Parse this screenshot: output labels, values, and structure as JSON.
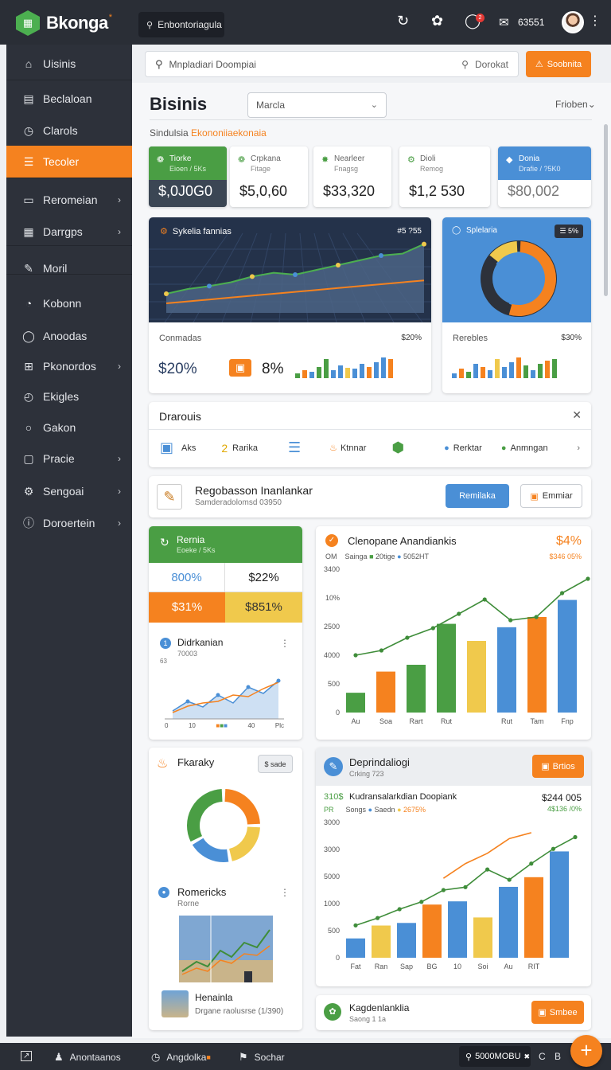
{
  "topbar": {
    "brand_name": "Bkonga",
    "brand_star": "*",
    "location": "Enbontoriagula",
    "mail_count": "63551",
    "notif_count": "2"
  },
  "sidebar": {
    "items": [
      {
        "label": "Uisinis",
        "icon": "home-icon",
        "arrow": false
      },
      {
        "label": "Beclaloan",
        "icon": "clipboard-icon",
        "arrow": false
      },
      {
        "label": "Clarols",
        "icon": "clock-icon",
        "arrow": false
      },
      {
        "label": "Tecoler",
        "icon": "list-icon",
        "arrow": false,
        "active": true
      },
      {
        "label": "Reromeian",
        "icon": "folder-icon",
        "arrow": true
      },
      {
        "label": "Darrgps",
        "icon": "calendar-icon",
        "arrow": true
      },
      {
        "label": "Moril",
        "icon": "pen-icon",
        "arrow": false
      },
      {
        "label": "Kobonn",
        "icon": "timer-icon",
        "arrow": false
      },
      {
        "label": "Anoodas",
        "icon": "bulb-icon",
        "arrow": false
      },
      {
        "label": "Pkonordos",
        "icon": "grid-icon",
        "arrow": true
      },
      {
        "label": "Ekigles",
        "icon": "alarm-icon",
        "arrow": false
      },
      {
        "label": "Gakon",
        "icon": "circle-icon",
        "arrow": false
      },
      {
        "label": "Pracie",
        "icon": "document-icon",
        "arrow": true
      },
      {
        "label": "Sengoai",
        "icon": "gear-icon",
        "arrow": true
      },
      {
        "label": "Doroertein",
        "icon": "info-icon",
        "arrow": true
      }
    ]
  },
  "search": {
    "placeholder": "Mnpladiari Doompiai",
    "right_label": "Dorokat",
    "button_label": "Soobnita"
  },
  "page": {
    "title": "Bisinis",
    "select_value": "Marcla",
    "filter_label": "Frioben",
    "subline_a": "Sindulsia",
    "subline_b": "Ekononiiaekonaia"
  },
  "kpis": [
    {
      "label": "Tiorke",
      "sub": "Eioen / 5Ks",
      "value": "$,0J0G0",
      "style": "green",
      "icon": "leaf-icon"
    },
    {
      "label": "Crpkana",
      "sub": "Fitage",
      "value": "$5,0,60",
      "style": "white",
      "icon": "leaf-icon"
    },
    {
      "label": "Nearleer",
      "sub": "Fnagsg",
      "value": "$33,320",
      "style": "white",
      "icon": "spark-icon"
    },
    {
      "label": "Dioli",
      "sub": "Remog",
      "value": "$1,2 530",
      "style": "white",
      "icon": "gear-icon"
    },
    {
      "label": "Donia",
      "sub": "Drafie / ?5K0",
      "value": "$80,002",
      "style": "blue",
      "icon": "shield-icon"
    }
  ],
  "overview": {
    "title": "Sykelia fannias",
    "corner": "#5 ?55",
    "foot_label": "Conmadas",
    "foot_pct": "$20%",
    "stat_a": "$20%",
    "stat_b": "8%"
  },
  "donut_card": {
    "title": "Splelaria",
    "badge": "☰ 5%",
    "foot_label": "Rerebles",
    "foot_pct": "$30%"
  },
  "drarouis": {
    "title": "Drarouis",
    "tabs": [
      "Aks",
      "Rarika",
      "",
      "Ktnnar",
      "",
      "Rerktar",
      "Anmngan"
    ],
    "tab_numeral": "2"
  },
  "regobasson": {
    "title": "Regobasson Inanlankar",
    "sub": "Samderadolomsd 03950",
    "btn_primary": "Remilaka",
    "btn_secondary": "Emmiar"
  },
  "mini_card": {
    "title": "Rernia",
    "sub": "Eoeke / 5Ks",
    "cells": [
      "800%",
      "$22%",
      "$31%",
      "$851%"
    ],
    "sub_title": "Didrkanian",
    "sub_sub": "70003",
    "y_top": "63",
    "x_labels": [
      "0",
      "10",
      "",
      "40",
      "Plc"
    ]
  },
  "main_chart": {
    "title": "Clenopane Anandiankis",
    "pct": "$4%",
    "sub_pct": "$346 05%",
    "legend_prefix": "OM",
    "legend_a": "Sainga",
    "legend_b": "20tige",
    "legend_c": "5052HT"
  },
  "fkaraky": {
    "title": "Fkaraky",
    "btn": "$ sade"
  },
  "romericks": {
    "title": "Romericks",
    "sub": "Rorne"
  },
  "henainla": {
    "title": "Henainla",
    "sub": "Drgane raolusrse (1/390)"
  },
  "dep_chart": {
    "title": "Deprindaliogi",
    "sub": "Crking 723",
    "btn": "Brtios",
    "head_left": "Kudransalarkdian Doopiank",
    "head_left_num": "310$",
    "head_right": "$244 005",
    "head_right_sub": "4$136 /0%",
    "legend_a": "Songs",
    "legend_b": "Saedn",
    "legend_c": "2675%",
    "legend_prefix": "PR"
  },
  "kagden": {
    "title": "Kagdenlanklia",
    "sub": "Saong 1 1a",
    "btn": "Smbee"
  },
  "bottombar": {
    "a": "Anontaanos",
    "b": "Angdolka",
    "c": "Sochar",
    "search": "5000MOBU",
    "d": "C",
    "e": "B"
  },
  "colors": {
    "orange": "#f5821f",
    "green": "#4a9e44",
    "blue": "#4a8fd6",
    "yellow": "#f0c94c",
    "dark": "#2d313a"
  },
  "chart_data": [
    {
      "type": "line",
      "title": "Sykelia fannias",
      "series": [
        {
          "values": [
            20,
            25,
            28,
            32,
            38,
            42,
            40,
            45,
            50,
            55,
            60,
            62,
            72
          ]
        },
        {
          "values": [
            10,
            12,
            14,
            16,
            18,
            20,
            22,
            24,
            26,
            28,
            30,
            32,
            34
          ]
        }
      ]
    },
    {
      "type": "pie",
      "title": "Splelaria",
      "values": [
        55,
        30,
        15
      ],
      "colors": [
        "#f5821f",
        "#2d313a",
        "#f0c94c"
      ]
    },
    {
      "type": "bar",
      "title": "Clenopane Anandiankis",
      "categories": [
        "Au",
        "Soa",
        "Rart",
        "Rut",
        "",
        "Rut",
        "Tam",
        "Fnp"
      ],
      "values": [
        580,
        1200,
        1400,
        2600,
        2100,
        2500,
        2800,
        3300
      ],
      "line": [
        1800,
        1950,
        2350,
        2650,
        3100,
        3550,
        2900,
        3000,
        3750,
        4200
      ],
      "y_ticks": [
        "3400",
        "10%",
        "2500",
        "4000",
        "500",
        "0"
      ]
    },
    {
      "type": "bar",
      "title": "Deprindaliogi",
      "categories": [
        "Fat",
        "Ran",
        "Sap",
        "BG",
        "10",
        "Soi",
        "Au",
        "RIT"
      ],
      "values": [
        600,
        1000,
        1080,
        1650,
        1750,
        1250,
        2200,
        2500,
        3300
      ],
      "line": [
        1100,
        1350,
        1650,
        1900,
        2300,
        2400,
        3000,
        2650,
        3200,
        3700,
        4100
      ],
      "y_ticks": [
        "3000",
        "3000",
        "5000",
        "1000",
        "500",
        "0"
      ]
    },
    {
      "type": "pie",
      "title": "Fkaraky",
      "values": [
        25,
        22,
        20,
        33
      ],
      "colors": [
        "#f5821f",
        "#f0c94c",
        "#4a8fd6",
        "#4a9e44"
      ]
    }
  ]
}
